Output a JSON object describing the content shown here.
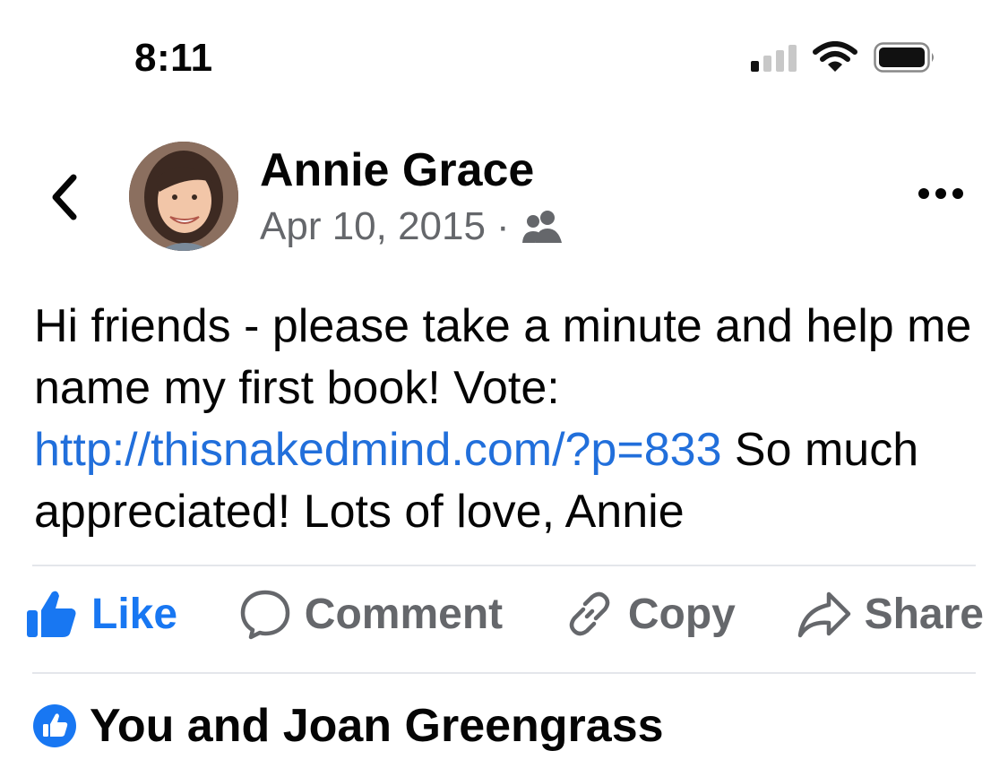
{
  "status_bar": {
    "time": "8:11",
    "signal_icon": "cellular-signal-icon",
    "wifi_icon": "wifi-icon",
    "battery_icon": "battery-icon"
  },
  "header": {
    "back_icon": "chevron-left-icon",
    "author": "Annie Grace",
    "date": "Apr 10, 2015",
    "separator": "·",
    "audience_icon": "friends-icon",
    "more_icon": "more-horizontal-icon"
  },
  "post": {
    "text_before": "Hi friends - please take a minute and help me name my first book! Vote: ",
    "link": "http://thisnakedmind.com/?p=833",
    "text_after": " So much appreciated! Lots of love, Annie"
  },
  "actions": {
    "like": "Like",
    "comment": "Comment",
    "copy": "Copy",
    "share": "Share"
  },
  "reactions": {
    "icon": "like-badge-icon",
    "text": "You and Joan Greengrass"
  },
  "colors": {
    "accent": "#1877f2",
    "link": "#216fdb",
    "muted": "#65676b",
    "divider": "#e4e6eb"
  }
}
